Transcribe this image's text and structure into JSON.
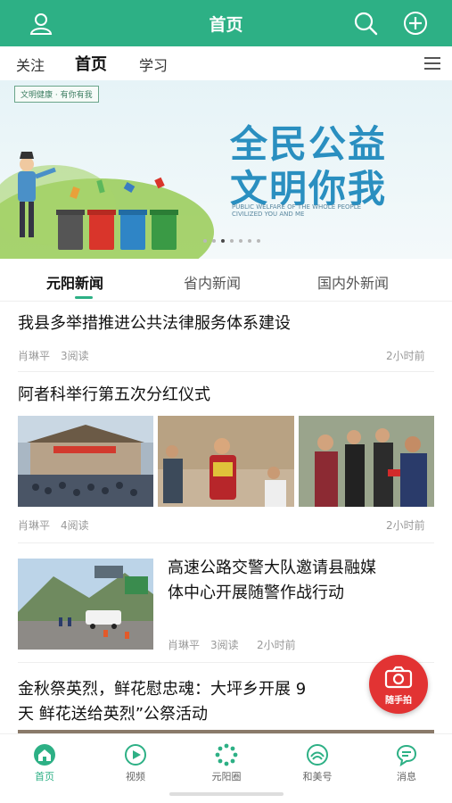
{
  "header": {
    "title": "首页"
  },
  "topnav": {
    "tabs": [
      "关注",
      "首页",
      "学习"
    ]
  },
  "banner": {
    "stamp": "文明健康 · 有你有我",
    "headline_1": "全民公益",
    "headline_2": "文明你我",
    "sub_1": "PUBLIC WELFARE OF THE WHOLE PEOPLE",
    "sub_2": "CIVILIZED YOU AND ME"
  },
  "news_tabs": [
    "元阳新闻",
    "省内新闻",
    "国内外新闻"
  ],
  "articles": [
    {
      "title": "我县多举措推进公共法律服务体系建设",
      "author": "肖琳平",
      "reads": "3阅读",
      "time": "2小时前"
    },
    {
      "title": "阿者科举行第五次分红仪式",
      "author": "肖琳平",
      "reads": "4阅读",
      "time": "2小时前"
    },
    {
      "title_1": "高速公路交警大队邀请县融媒",
      "title_2": "体中心开展随警作战行动",
      "author": "肖琳平",
      "reads": "3阅读",
      "time": "2小时前"
    },
    {
      "title_1": "金秋祭英烈，鲜花慰忠魂：大坪乡开展 9",
      "title_2": "天 鲜花送给英烈”公祭活动"
    }
  ],
  "float_button": {
    "label": "随手拍"
  },
  "bottom_nav": [
    "首页",
    "视频",
    "元阳圈",
    "和美号",
    "消息"
  ],
  "colors": {
    "brand": "#2db085",
    "float": "#e23333"
  }
}
